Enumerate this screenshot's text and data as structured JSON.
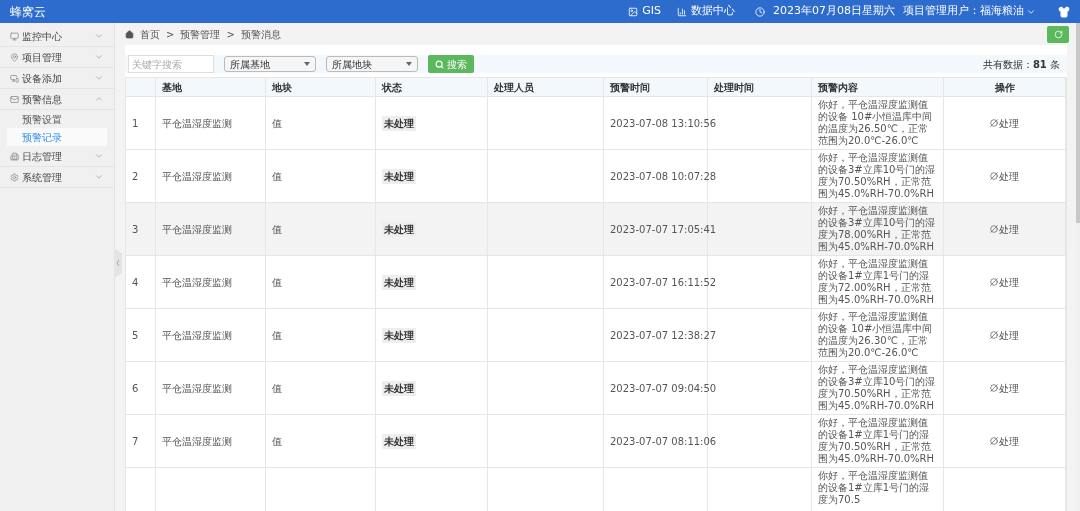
{
  "app": {
    "title": "蜂窝云"
  },
  "topbar": {
    "gis": "GIS",
    "data_center": "数据中心",
    "date": "2023年07月08日星期六",
    "user": "项目管理用户：福海粮油"
  },
  "sidebar": {
    "items": [
      {
        "label": "监控中心",
        "expanded": false
      },
      {
        "label": "项目管理",
        "expanded": false
      },
      {
        "label": "设备添加",
        "expanded": false
      },
      {
        "label": "预警信息",
        "expanded": true,
        "children": [
          {
            "label": "预警设置",
            "selected": false
          },
          {
            "label": "预警记录",
            "selected": true
          }
        ]
      },
      {
        "label": "日志管理",
        "expanded": false
      },
      {
        "label": "系统管理",
        "expanded": false
      }
    ]
  },
  "breadcrumb": [
    {
      "label": "首页"
    },
    {
      "separator": ">",
      "label": "预警管理"
    },
    {
      "separator": ">",
      "label": "预警消息"
    }
  ],
  "filters": {
    "keyword": {
      "placeholder": "关键字搜索"
    },
    "base": {
      "value": "所属基地"
    },
    "plot": {
      "value": "所属地块"
    },
    "search_button": "搜索",
    "total": "共有数据：**81** 条"
  },
  "table": {
    "columns": [
      "",
      "基地",
      "地块",
      "状态",
      "处理人员",
      "预警时间",
      "处理时间",
      "预警内容",
      "操作"
    ],
    "rows": [
      {
        "number": "1",
        "base": "平仓温湿度监测",
        "plot": "值",
        "status": "未处理",
        "alert_time": "2023-07-08 13:10:56",
        "content": "你好，平仓温湿度监测值的设备 10#小恒温库中间的温度为26.50℃，正常范围为20.0℃-26.0℃",
        "action": "处理",
        "highlighted": false
      },
      {
        "number": "2",
        "base": "平仓温湿度监测",
        "plot": "值",
        "status": "未处理",
        "alert_time": "2023-07-08 10:07:28",
        "content": "你好，平仓温湿度监测值的设备3#立库10号门的湿度为70.50%RH，正常范围为45.0%RH-70.0%RH",
        "action": "处理",
        "highlighted": false
      },
      {
        "number": "3",
        "base": "平仓温湿度监测",
        "plot": "值",
        "status": "未处理",
        "alert_time": "2023-07-07 17:05:41",
        "content": "你好，平仓温湿度监测值的设备3#立库10号门的湿度为78.00%RH，正常范围为45.0%RH-70.0%RH",
        "action": "处理",
        "highlighted": true
      },
      {
        "number": "4",
        "base": "平仓温湿度监测",
        "plot": "值",
        "status": "未处理",
        "alert_time": "2023-07-07 16:11:52",
        "content": "你好，平仓温湿度监测值的设备1#立库1号门的湿度为72.00%RH，正常范围为45.0%RH-70.0%RH",
        "action": "处理",
        "highlighted": false
      },
      {
        "number": "5",
        "base": "平仓温湿度监测",
        "plot": "值",
        "status": "未处理",
        "alert_time": "2023-07-07 12:38:27",
        "content": "你好，平仓温湿度监测值的设备 10#小恒温库中间的温度为26.30℃，正常范围为20.0℃-26.0℃",
        "action": "处理",
        "highlighted": false
      },
      {
        "number": "6",
        "base": "平仓温湿度监测",
        "plot": "值",
        "status": "未处理",
        "alert_time": "2023-07-07 09:04:50",
        "content": "你好，平仓温湿度监测值的设备3#立库10号门的湿度为70.50%RH，正常范围为45.0%RH-70.0%RH",
        "action": "处理",
        "highlighted": false
      },
      {
        "number": "7",
        "base": "平仓温湿度监测",
        "plot": "值",
        "status": "未处理",
        "alert_time": "2023-07-07 08:11:06",
        "content": "你好，平仓温湿度监测值的设备1#立库1号门的湿度为70.50%RH，正常范围为45.0%RH-70.0%RH",
        "action": "处理",
        "highlighted": false
      },
      {
        "content": "你好，平仓温湿度监测值的设备1#立库1号门的湿度为70.5",
        "highlighted": false
      }
    ]
  }
}
